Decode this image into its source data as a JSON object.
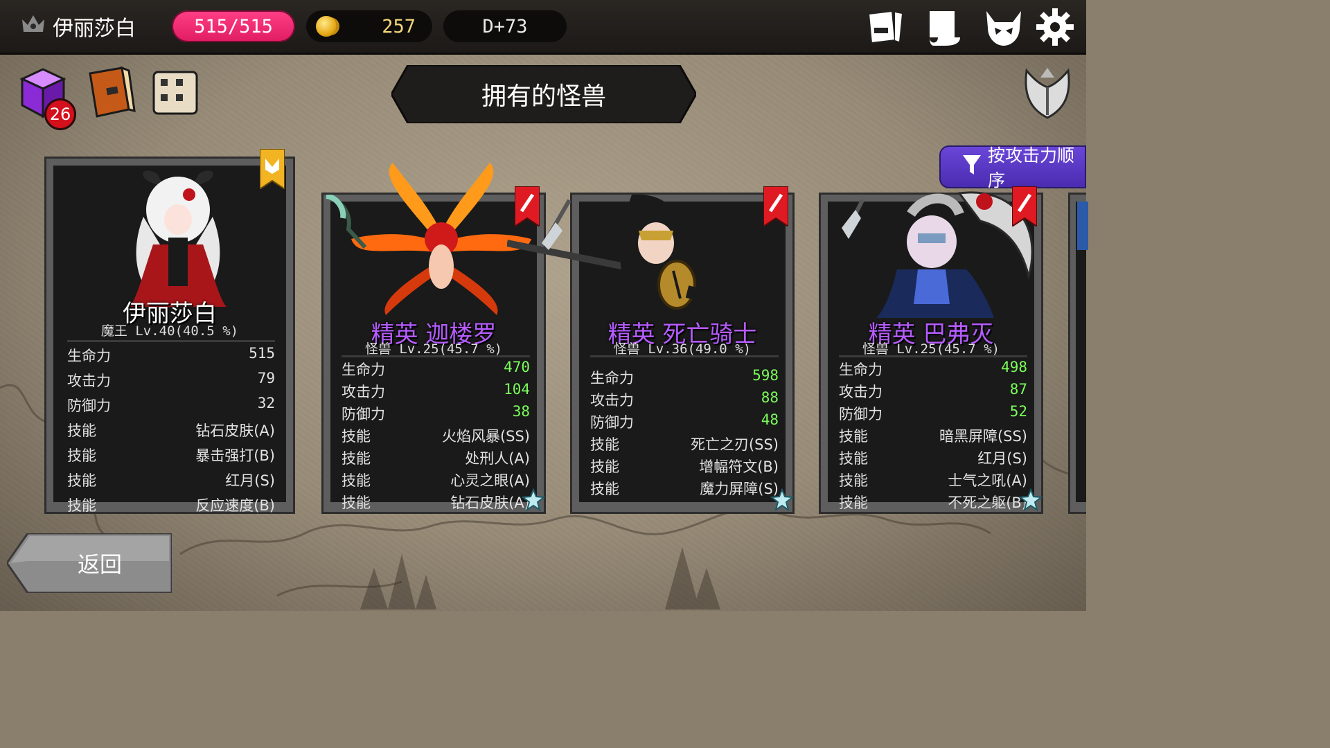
{
  "player": {
    "name": "伊丽莎白",
    "hp": "515/515",
    "gold": "257",
    "day": "D+73",
    "inventory_badge": "26"
  },
  "title": "拥有的怪兽",
  "sort_button": "按攻击力顺序",
  "back_button": "返回",
  "icons": [
    "crown-icon",
    "journal-icon",
    "map-scroll-icon",
    "demon-skull-icon",
    "gear-icon",
    "magic-box-icon",
    "book-icon",
    "recipe-scroll-icon",
    "angel-emblem-icon"
  ],
  "cards": [
    {
      "name": "伊丽莎白",
      "elite": false,
      "prefix": "",
      "level": "魔王 Lv.40(40.5 %)",
      "stats": [
        {
          "label": "生命力",
          "value": "515"
        },
        {
          "label": "攻击力",
          "value": "79"
        },
        {
          "label": "防御力",
          "value": "32"
        },
        {
          "label": "技能",
          "value": "钻石皮肤(A)"
        },
        {
          "label": "技能",
          "value": "暴击强打(B)"
        },
        {
          "label": "技能",
          "value": "红月(S)"
        },
        {
          "label": "技能",
          "value": "反应速度(B)"
        }
      ]
    },
    {
      "name": "迦楼罗",
      "elite": true,
      "prefix": "精英",
      "level": "怪兽 Lv.25(45.7 %)",
      "stats": [
        {
          "label": "生命力",
          "value": "470"
        },
        {
          "label": "攻击力",
          "value": "104"
        },
        {
          "label": "防御力",
          "value": "38"
        },
        {
          "label": "技能",
          "value": "火焰风暴(SS)"
        },
        {
          "label": "技能",
          "value": "处刑人(A)"
        },
        {
          "label": "技能",
          "value": "心灵之眼(A)"
        },
        {
          "label": "技能",
          "value": "钻石皮肤(A)"
        }
      ]
    },
    {
      "name": "死亡骑士",
      "elite": true,
      "prefix": "精英",
      "level": "怪兽 Lv.36(49.0 %)",
      "stats": [
        {
          "label": "生命力",
          "value": "598"
        },
        {
          "label": "攻击力",
          "value": "88"
        },
        {
          "label": "防御力",
          "value": "48"
        },
        {
          "label": "技能",
          "value": "死亡之刃(SS)"
        },
        {
          "label": "技能",
          "value": "增幅符文(B)"
        },
        {
          "label": "技能",
          "value": "魔力屏障(S)"
        }
      ]
    },
    {
      "name": "巴弗灭",
      "elite": true,
      "prefix": "精英",
      "level": "怪兽 Lv.25(45.7 %)",
      "stats": [
        {
          "label": "生命力",
          "value": "498"
        },
        {
          "label": "攻击力",
          "value": "87"
        },
        {
          "label": "防御力",
          "value": "52"
        },
        {
          "label": "技能",
          "value": "暗黑屏障(SS)"
        },
        {
          "label": "技能",
          "value": "红月(S)"
        },
        {
          "label": "技能",
          "value": "士气之吼(A)"
        },
        {
          "label": "技能",
          "value": "不死之躯(B)"
        }
      ]
    }
  ],
  "colors": {
    "hp_pill": "#ff3f86",
    "elite_name": "#b65cff",
    "stat_value_green": "#7bff5a",
    "sort_button": "#5a38c8"
  }
}
